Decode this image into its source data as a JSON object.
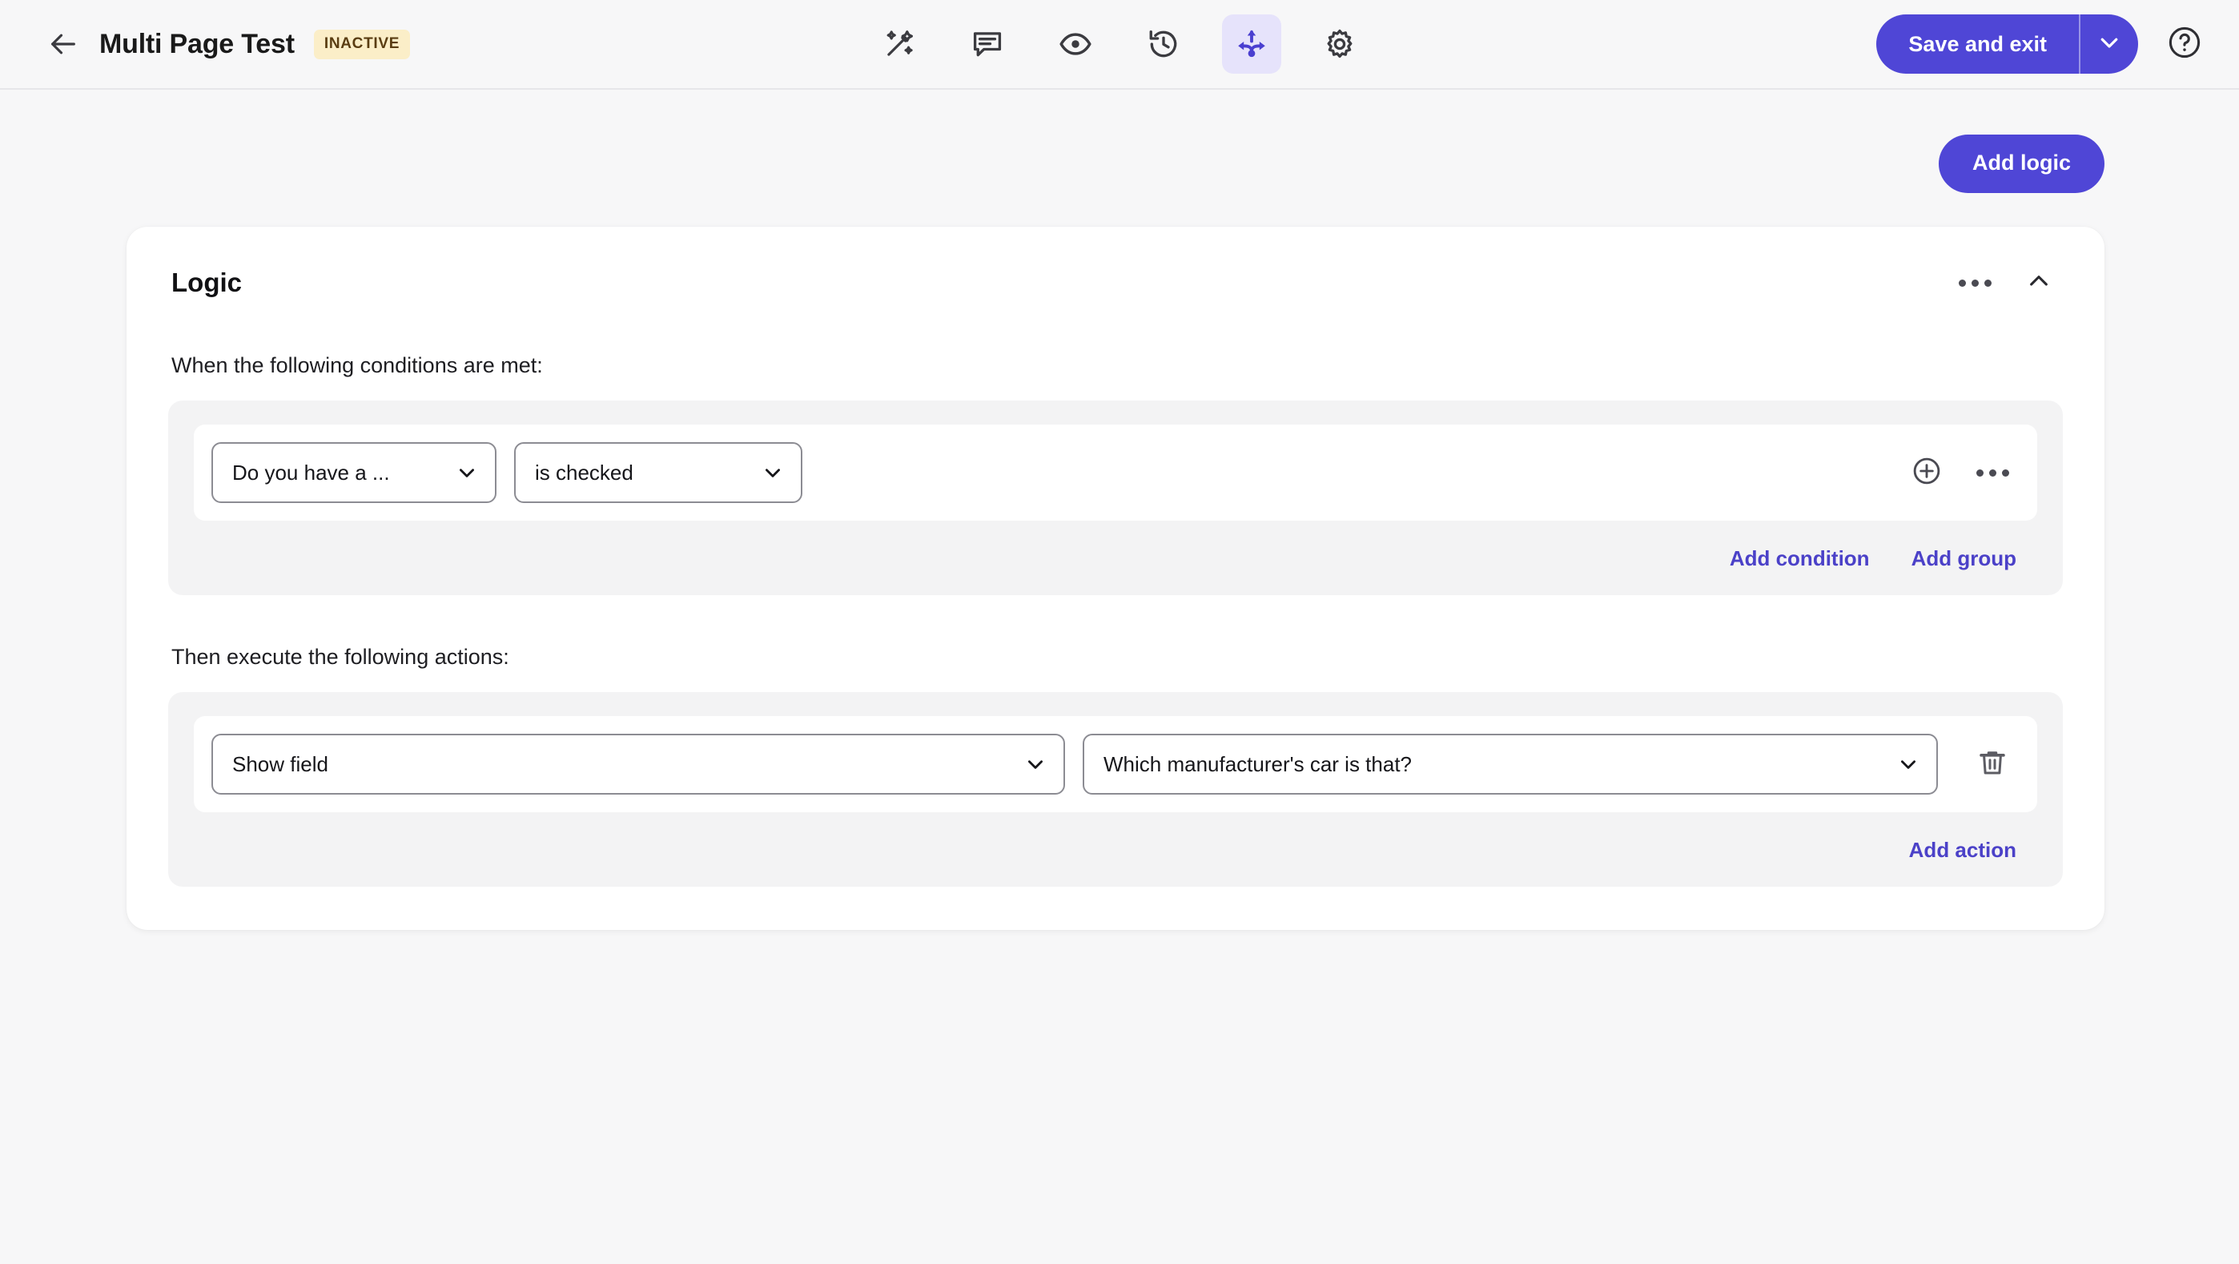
{
  "topbar": {
    "back_icon": "arrow-left-icon",
    "title": "Multi Page Test",
    "status": "INACTIVE",
    "tools": [
      {
        "name": "magic-wand-icon",
        "label": "Design",
        "active": false
      },
      {
        "name": "comment-icon",
        "label": "Comments",
        "active": false
      },
      {
        "name": "eye-icon",
        "label": "Preview",
        "active": false
      },
      {
        "name": "history-icon",
        "label": "History",
        "active": false
      },
      {
        "name": "logic-flow-icon",
        "label": "Logic",
        "active": true
      },
      {
        "name": "gear-icon",
        "label": "Settings",
        "active": false
      }
    ],
    "save_label": "Save and exit",
    "save_caret_icon": "chevron-down-icon",
    "help_icon": "question-circle-icon"
  },
  "page": {
    "add_logic_label": "Add logic"
  },
  "logic_card": {
    "title": "Logic",
    "more_icon": "ellipsis-icon",
    "collapse_icon": "chevron-up-icon",
    "conditions_label": "When the following conditions are met:",
    "actions_label": "Then execute the following actions:",
    "condition": {
      "field_value": "Do you have a ...",
      "operator_value": "is checked",
      "add_icon": "plus-circle-icon",
      "more_icon": "ellipsis-icon"
    },
    "condition_links": {
      "add_condition": "Add condition",
      "add_group": "Add group"
    },
    "action": {
      "type_value": "Show field",
      "target_value": "Which manufacturer's car is that?",
      "delete_icon": "trash-icon"
    },
    "action_links": {
      "add_action": "Add action"
    }
  },
  "colors": {
    "accent": "#4f46d6",
    "link": "#4b41c8",
    "active_tool_bg": "#e6e3fb",
    "badge_bg": "#fbeec8",
    "badge_text": "#5a3d12",
    "page_bg": "#f7f7f8",
    "card_bg": "#ffffff",
    "group_bg": "#f3f3f4"
  }
}
